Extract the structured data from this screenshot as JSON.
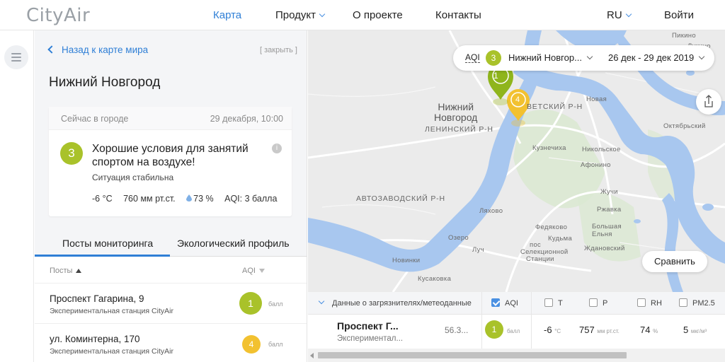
{
  "header": {
    "logo": "CityAir",
    "nav": [
      "Карта",
      "Продукт",
      "О проекте",
      "Контакты"
    ],
    "lang": "RU",
    "login": "Войти"
  },
  "panel": {
    "back": "Назад к карте мира",
    "close": "[ закрыть ]",
    "city": "Нижний Новгород",
    "card": {
      "now_label": "Сейчас в городе",
      "datetime": "29 декабря, 10:00",
      "aqi": "3",
      "condition": "Хорошие условия для занятий спортом на воздухе!",
      "situation": "Ситуация стабильна",
      "temp": "-6 °C",
      "pressure": "760 мм рт.ст.",
      "humidity": "73 %",
      "aqi_text": "AQI: 3 балла"
    },
    "tabs": [
      "Посты мониторинга",
      "Экологический профиль"
    ],
    "list": {
      "col_posts": "Посты",
      "col_aqi": "AQI",
      "unit": "балл",
      "rows": [
        {
          "name": "Проспект Гагарина, 9",
          "sub": "Экспериментальная станция CityAir",
          "aqi": "1"
        },
        {
          "name": "ул. Коминтерна, 170",
          "sub": "Экспериментальная станция CityAir",
          "aqi": "4"
        }
      ]
    }
  },
  "colors": {
    "accent": "#2f7fd6",
    "aqi_good": "#a9c22a",
    "aqi_moderate": "#f2c130",
    "water": "#a8c7ef"
  },
  "map": {
    "filter": {
      "aqi_label": "AQI",
      "aqi_value": "3",
      "city": "Нижний Новгор...",
      "dates": "26 дек - 29 дек 2019"
    },
    "compare": "Сравнить",
    "city_label_1": "Нижний",
    "city_label_2": "Новгород",
    "markers": [
      "1",
      "4"
    ],
    "labels": {
      "leninsky": "ЛЕНИНСКИЙ Р-Н",
      "sovetsky": "ВЕТСКИЙ Р-Н",
      "avtozavodsky": "АВТОЗАВОДСКИЙ Р-Н",
      "pikino": "Пикино",
      "lukino": "Лукино",
      "novaya": "Новая",
      "oktyabrsky": "Октябрьский",
      "kuznechikha": "Кузнечиха",
      "nikolskoe": "Никольское",
      "afonino": "Афонино",
      "zhuchi": "Жучи",
      "rzhavka": "Ржавка",
      "bolshaya_elnya": "Большая Ельня",
      "lyakhovo": "Ляхово",
      "fedyakovo": "Федяково",
      "kudma": "Кудьма",
      "zhdanovsky": "Ждановский",
      "ozero": "Озеро",
      "luch": "Луч",
      "pos": "пос",
      "sellektsionnoy": "Селекционной",
      "stantsii": "Станции",
      "novinki": "Новинки",
      "kusakovka": "Кусаковка"
    }
  },
  "table": {
    "header_label": "Данные о загрязнителях/метеоданные",
    "cols": [
      "AQI",
      "T",
      "P",
      "RH",
      "PM2.5"
    ],
    "row": {
      "station": "Проспект Г...",
      "sub": "Экспериментал...",
      "num": "56.3...",
      "aqi": "1",
      "aqi_unit": "балл",
      "t": "-6",
      "t_unit": "°C",
      "p": "757",
      "p_unit": "мм рт.ст.",
      "rh": "74",
      "rh_unit": "%",
      "pm": "5",
      "pm_unit": "мкг/м³"
    }
  }
}
